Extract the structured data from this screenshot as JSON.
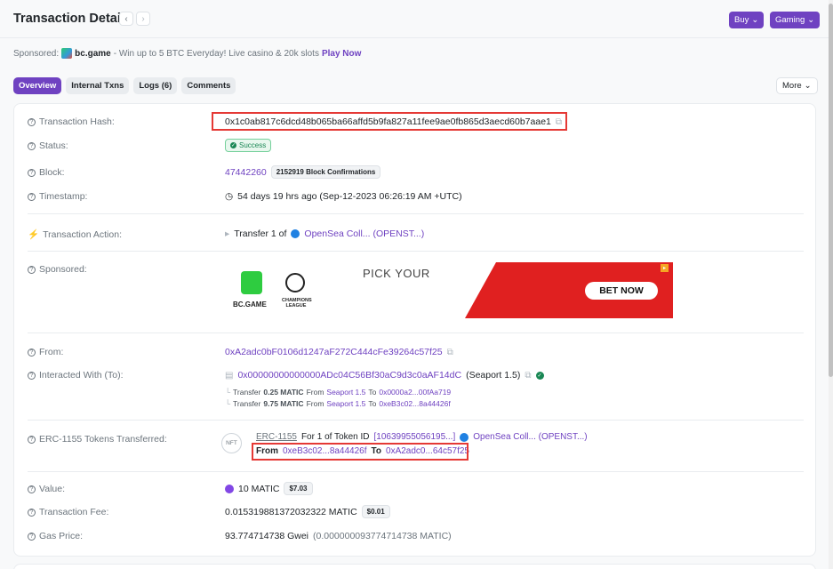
{
  "header": {
    "title": "Transaction Details",
    "prev": "‹",
    "next": "›",
    "buy_label": "Buy",
    "gaming_label": "Gaming"
  },
  "sponsored_bar": {
    "prefix": "Sponsored:",
    "brand": "bc.game",
    "text": "- Win up to 5 BTC Everyday! Live casino & 20k slots",
    "cta": "Play Now"
  },
  "tabs": [
    {
      "label": "Overview",
      "active": true
    },
    {
      "label": "Internal Txns",
      "active": false
    },
    {
      "label": "Logs (6)",
      "active": false
    },
    {
      "label": "Comments",
      "active": false
    }
  ],
  "more_label": "More",
  "details": {
    "tx_hash_label": "Transaction Hash:",
    "tx_hash": "0x1c0ab817c6dcd48b065ba66affd5b9fa827a11fee9ae0fb865d3aecd60b7aae1",
    "status_label": "Status:",
    "status": "Success",
    "block_label": "Block:",
    "block": "47442260",
    "confirmations": "2152919 Block Confirmations",
    "timestamp_label": "Timestamp:",
    "timestamp": "54 days 19 hrs ago (Sep-12-2023 06:26:19 AM +UTC)",
    "action_label": "Transaction Action:",
    "action_prefix": "Transfer 1 of",
    "action_token": "OpenSea Coll... (OPENST...)",
    "sponsored_label": "Sponsored:",
    "from_label": "From:",
    "from": "0xA2adc0bF0106d1247aF272C444cFe39264c57f25",
    "to_label": "Interacted With (To):",
    "to_address": "0x00000000000000ADc04C56Bf30aC9d3c0aAF14dC",
    "to_name": "(Seaport 1.5)",
    "internal": [
      {
        "prefix": "Transfer",
        "amount": "0.25 MATIC",
        "from_word": "From",
        "from": "Seaport 1.5",
        "to_word": "To",
        "to": "0x0000a2...00fAa719"
      },
      {
        "prefix": "Transfer",
        "amount": "9.75 MATIC",
        "from_word": "From",
        "from": "Seaport 1.5",
        "to_word": "To",
        "to": "0xeB3c02...8a44426f"
      }
    ],
    "erc_label": "ERC-1155 Tokens Transferred:",
    "erc_type": "ERC-1155",
    "erc_text": "For 1 of Token ID",
    "erc_token_id": "[10639955056195...]",
    "erc_collection": "OpenSea Coll... (OPENST...)",
    "erc_from_word": "From",
    "erc_from": "0xeB3c02...8a44426f",
    "erc_to_word": "To",
    "erc_to": "0xA2adc0...64c57f25",
    "nft_icon_text": "NFT",
    "value_label": "Value:",
    "value": "10 MATIC",
    "value_usd": "$7.03",
    "fee_label": "Transaction Fee:",
    "fee": "0.015319881372032322 MATIC",
    "fee_usd": "$0.01",
    "gas_label": "Gas Price:",
    "gas": "93.774714738 Gwei",
    "gas_matic": "(0.000000093774714738 MATIC)"
  },
  "ad": {
    "brand": "BC.GAME",
    "league": "CHAMPIONS LEAGUE",
    "headline": "PICK YOUR",
    "cta": "BET NOW"
  },
  "colors": {
    "accent": "#6f42c1",
    "success": "#198754",
    "highlight": "#e53935"
  }
}
